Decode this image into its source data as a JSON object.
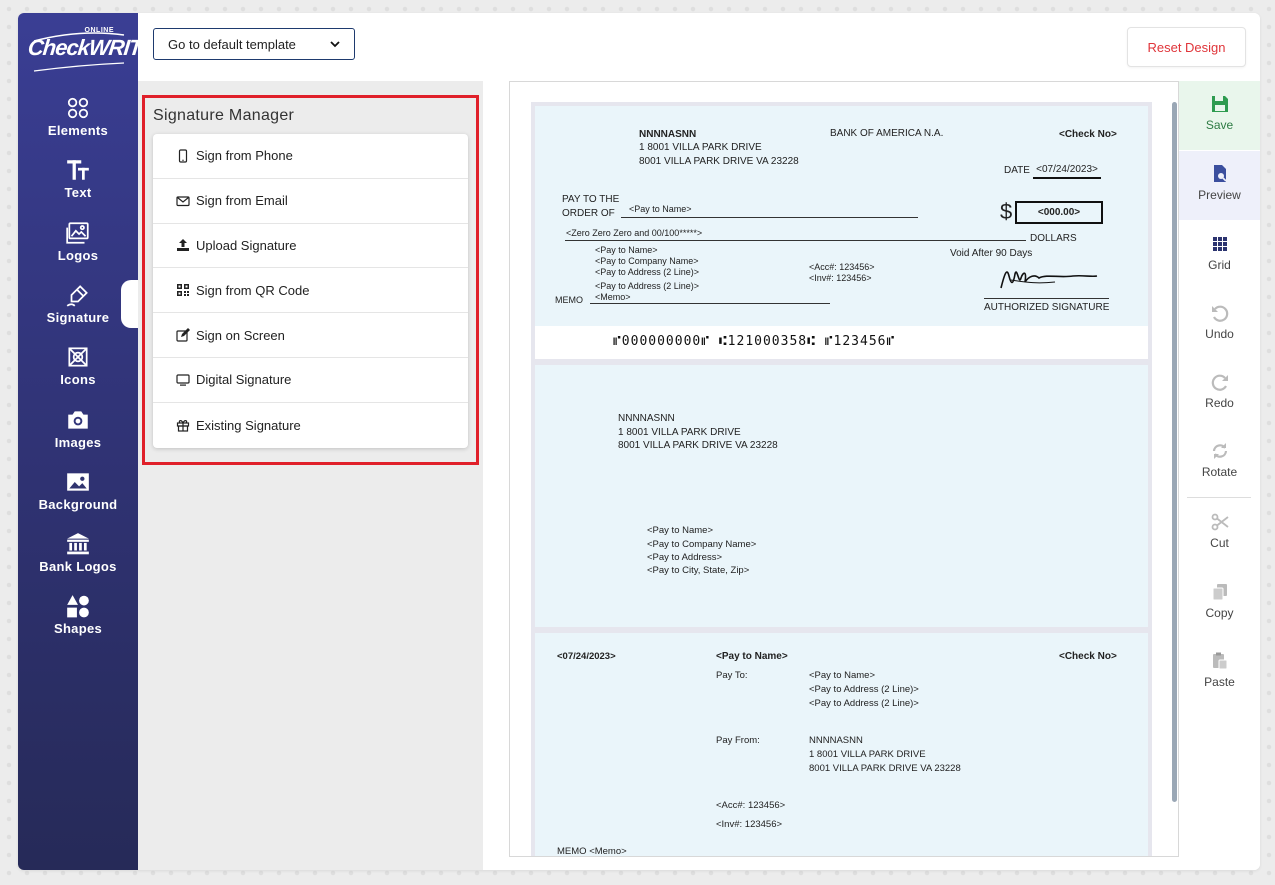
{
  "app": {
    "logo_small": "ONLINE",
    "logo_brand": "CheckWRITER"
  },
  "nav": {
    "items": [
      {
        "label": "Elements",
        "icon": "elements-icon"
      },
      {
        "label": "Text",
        "icon": "text-icon"
      },
      {
        "label": "Logos",
        "icon": "logos-icon"
      },
      {
        "label": "Signature",
        "icon": "signature-pen-icon",
        "active": true
      },
      {
        "label": "Icons",
        "icon": "icons-icon"
      },
      {
        "label": "Images",
        "icon": "camera-icon"
      },
      {
        "label": "Background",
        "icon": "image-icon"
      },
      {
        "label": "Bank Logos",
        "icon": "bank-icon"
      },
      {
        "label": "Shapes",
        "icon": "shapes-icon"
      }
    ]
  },
  "topbar": {
    "template_select": "Go to default template",
    "reset_label": "Reset Design",
    "reset_color": "#e0353a"
  },
  "panel": {
    "title": "Signature Manager",
    "items": [
      {
        "label": "Sign from Phone",
        "icon": "phone-icon"
      },
      {
        "label": "Sign from Email",
        "icon": "envelope-icon"
      },
      {
        "label": "Upload Signature",
        "icon": "upload-icon"
      },
      {
        "label": "Sign from QR Code",
        "icon": "qr-code-icon"
      },
      {
        "label": "Sign on Screen",
        "icon": "edit-icon"
      },
      {
        "label": "Digital Signature",
        "icon": "monitor-icon"
      },
      {
        "label": "Existing Signature",
        "icon": "gift-icon"
      }
    ]
  },
  "check": {
    "payer_name": "NNNNASNN",
    "payer_addr1": "1 8001 VILLA PARK DRIVE",
    "payer_addr2": "8001 VILLA PARK DRIVE VA 23228",
    "bank_name": "BANK OF AMERICA N.A.",
    "check_no": "<Check No>",
    "date_label": "DATE",
    "date_value": "<07/24/2023>",
    "pay_to_line1": "PAY TO THE",
    "pay_to_line2": "ORDER OF",
    "pay_to_name": "<Pay to Name>",
    "dollar_sign": "$",
    "amount": "<000.00>",
    "amount_words": "<Zero Zero Zero and 00/100*****>",
    "dollars_label": "DOLLARS",
    "void_after": "Void After 90 Days",
    "payee_name": "<Pay to Name>",
    "payee_company": "<Pay to Company Name>",
    "payee_addr1": "<Pay to Address (2 Line)>",
    "payee_addr2": "<Pay to Address (2 Line)>",
    "acc": "<Acc#: 123456>",
    "inv": "<Inv#: 123456>",
    "memo_label": "MEMO",
    "memo_value": "<Memo>",
    "authorized_signature": "AUTHORIZED SIGNATURE",
    "micr": "⑈000000000⑈ ⑆121000358⑆ ⑈123456⑈"
  },
  "stub1": {
    "payer_name": "NNNNASNN",
    "payer_addr1": "1 8001 VILLA PARK DRIVE",
    "payer_addr2": "8001 VILLA PARK DRIVE VA 23228",
    "payee_name": "<Pay to Name>",
    "payee_company": "<Pay to Company Name>",
    "payee_address": "<Pay to Address>",
    "payee_city": "<Pay to City, State, Zip>"
  },
  "stub2": {
    "date": "<07/24/2023>",
    "pay_to_name": "<Pay to Name>",
    "check_no": "<Check No>",
    "pay_to_label": "Pay To:",
    "pay_to_1": "<Pay to Name>",
    "pay_to_2": "<Pay to Address (2 Line)>",
    "pay_to_3": "<Pay to Address (2 Line)>",
    "pay_from_label": "Pay From:",
    "pay_from_1": "NNNNASNN",
    "pay_from_2": "1 8001 VILLA PARK DRIVE",
    "pay_from_3": "8001 VILLA PARK DRIVE VA 23228",
    "acc": "<Acc#: 123456>",
    "inv": "<Inv#: 123456>",
    "memo": "MEMO  <Memo>"
  },
  "tools": {
    "items": [
      {
        "label": "Save",
        "icon": "save-icon"
      },
      {
        "label": "Preview",
        "icon": "preview-icon"
      },
      {
        "label": "Grid",
        "icon": "grid-icon"
      },
      {
        "label": "Undo",
        "icon": "undo-icon"
      },
      {
        "label": "Redo",
        "icon": "redo-icon"
      },
      {
        "label": "Rotate",
        "icon": "rotate-icon"
      },
      {
        "label": "Cut",
        "icon": "scissors-icon"
      },
      {
        "label": "Copy",
        "icon": "copy-icon"
      },
      {
        "label": "Paste",
        "icon": "paste-icon"
      }
    ]
  }
}
